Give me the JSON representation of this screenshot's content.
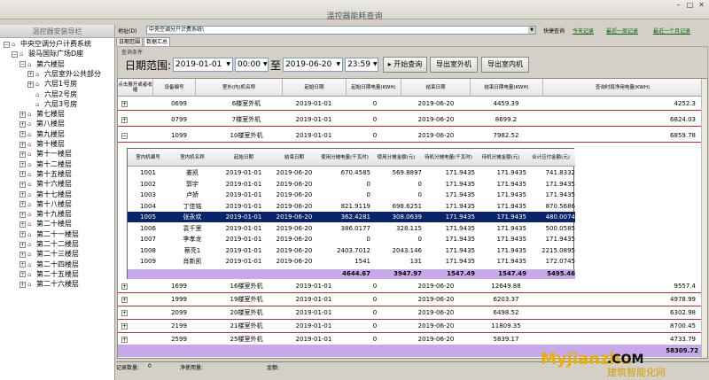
{
  "window": {
    "title": "温控器能耗查询"
  },
  "sidebar": {
    "header": "温控器安装导栏",
    "nodes": [
      {
        "label": "中央空调分户计费系统",
        "level": 0,
        "toggle": "⊟"
      },
      {
        "label": "骏马国际广场D座",
        "level": 1,
        "toggle": "⊟"
      },
      {
        "label": "第六楼层",
        "level": 2,
        "toggle": "⊟"
      },
      {
        "label": "六层室外公共部分",
        "level": 3,
        "toggle": "⊞"
      },
      {
        "label": "六层1号房",
        "level": 3,
        "toggle": "⊞"
      },
      {
        "label": "六层2号房",
        "level": 3,
        "toggle": ""
      },
      {
        "label": "六层3号房",
        "level": 3,
        "toggle": ""
      },
      {
        "label": "第七楼层",
        "level": 2,
        "toggle": "⊞"
      },
      {
        "label": "第八楼层",
        "level": 2,
        "toggle": "⊞"
      },
      {
        "label": "第九楼层",
        "level": 2,
        "toggle": "⊞"
      },
      {
        "label": "第十楼层",
        "level": 2,
        "toggle": "⊞"
      },
      {
        "label": "第十一楼层",
        "level": 2,
        "toggle": "⊞"
      },
      {
        "label": "第十二楼层",
        "level": 2,
        "toggle": "⊞"
      },
      {
        "label": "第十五楼层",
        "level": 2,
        "toggle": "⊞"
      },
      {
        "label": "第十六楼层",
        "level": 2,
        "toggle": "⊞"
      },
      {
        "label": "第十七楼层",
        "level": 2,
        "toggle": "⊞"
      },
      {
        "label": "第十八楼层",
        "level": 2,
        "toggle": "⊞"
      },
      {
        "label": "第十九楼层",
        "level": 2,
        "toggle": "⊞"
      },
      {
        "label": "第二十楼层",
        "level": 2,
        "toggle": "⊞"
      },
      {
        "label": "第二十一楼层",
        "level": 2,
        "toggle": "⊞"
      },
      {
        "label": "第二十二楼层",
        "level": 2,
        "toggle": "⊞"
      },
      {
        "label": "第二十三楼层",
        "level": 2,
        "toggle": "⊞"
      },
      {
        "label": "第二十四楼层",
        "level": 2,
        "toggle": "⊞"
      },
      {
        "label": "第二十五楼层",
        "level": 2,
        "toggle": "⊞"
      },
      {
        "label": "第二十六楼层",
        "level": 2,
        "toggle": "⊞"
      }
    ]
  },
  "topbar": {
    "path_label": "地址(D)",
    "path_value": "中央空调分户计费系统\\",
    "quick_label": "快捷查询",
    "links": [
      "今天记录",
      "最近一周记录",
      "最近一个月记录"
    ]
  },
  "tabs": [
    "日期范围",
    "数据汇总"
  ],
  "condition": {
    "title": "查询条件",
    "date_label": "日期范围:",
    "start_date": "2019-01-01",
    "start_time": "00:00",
    "to": "至",
    "end_date": "2019-06-20",
    "end_time": "23:59",
    "query_btn": "开始查询",
    "export_out_btn": "导出室外机",
    "export_in_btn": "导出室内机"
  },
  "grid": {
    "headers": [
      "点击展开或者收缩",
      "设备编号",
      "室外(内)机名称",
      "起始日期",
      "起始日期电量(KWH)",
      "结束日期",
      "结束日期电量(KWH)",
      "查询时段净用电量(KWH)"
    ],
    "rows_top": [
      {
        "id": "0699",
        "name": "6楼室外机",
        "start": "2019-01-01",
        "se": "0",
        "end": "2019-06-20",
        "ee": "4459.39",
        "net": "4252.3"
      },
      {
        "id": "0799",
        "name": "7楼室外机",
        "start": "2019-01-01",
        "se": "0",
        "end": "2019-06-20",
        "ee": "8699.2",
        "net": "6824.03"
      },
      {
        "id": "1099",
        "name": "10楼室外机",
        "start": "2019-01-01",
        "se": "0",
        "end": "2019-06-20",
        "ee": "7982.52",
        "net": "6859.78"
      }
    ],
    "rows_bottom": [
      {
        "id": "1699",
        "name": "16楼室外机",
        "start": "2019-01-01",
        "se": "0",
        "end": "2019-06-20",
        "ee": "12649.88",
        "net": "9557.4"
      },
      {
        "id": "1999",
        "name": "19楼室外机",
        "start": "2019-01-01",
        "se": "0",
        "end": "2019-06-20",
        "ee": "6203.37",
        "net": "4978.99"
      },
      {
        "id": "2099",
        "name": "20楼室外机",
        "start": "2019-01-01",
        "se": "0",
        "end": "2019-06-20",
        "ee": "6498.52",
        "net": "6302.98"
      },
      {
        "id": "2199",
        "name": "21楼室外机",
        "start": "2019-01-01",
        "se": "0",
        "end": "2019-06-20",
        "ee": "11809.35",
        "net": "8700.45"
      },
      {
        "id": "2599",
        "name": "25楼室外机",
        "start": "2019-01-01",
        "se": "0",
        "end": "2019-06-20",
        "ee": "5839.17",
        "net": "4733.79"
      }
    ],
    "grand_total": "58309.72"
  },
  "sub": {
    "headers": [
      "室内机编号",
      "室内机名称",
      "起始日期",
      "结束日期",
      "使用分摊电量(千瓦时)",
      "使用分摊金额(元)",
      "待机分摊电量(千瓦时)",
      "待机分摊金额(元)",
      "合计应付金额(元)"
    ],
    "rows": [
      [
        "1001",
        "姜凯",
        "2019-01-01",
        "2019-06-20",
        "670.4585",
        "569.8897",
        "171.9435",
        "171.9435",
        "741.8332"
      ],
      [
        "1002",
        "郭宇",
        "2019-01-01",
        "2019-06-20",
        "0",
        "0",
        "171.9435",
        "171.9435",
        "171.9435"
      ],
      [
        "1003",
        "卢娇",
        "2019-01-01",
        "2019-06-20",
        "0",
        "0",
        "171.9435",
        "171.9435",
        "171.9435"
      ],
      [
        "1004",
        "丁佳铭",
        "2019-01-01",
        "2019-06-20",
        "821.9119",
        "698.6251",
        "171.9435",
        "171.9435",
        "870.5686"
      ],
      [
        "1005",
        "张永欢",
        "2019-01-01",
        "2019-06-20",
        "362.4281",
        "308.0639",
        "171.9435",
        "171.9435",
        "480.0074"
      ],
      [
        "1006",
        "袁千里",
        "2019-01-01",
        "2019-06-20",
        "386.0177",
        "328.115",
        "171.9435",
        "171.9435",
        "500.0585"
      ],
      [
        "1007",
        "李孝龙",
        "2019-01-01",
        "2019-06-20",
        "0",
        "0",
        "171.9435",
        "171.9435",
        "171.9435"
      ],
      [
        "1008",
        "蔡亮1",
        "2019-01-01",
        "2019-06-20",
        "2403.7012",
        "2043.146",
        "171.9435",
        "171.9435",
        "2215.0895"
      ],
      [
        "1009",
        "肖新凯",
        "2019-01-01",
        "2019-06-20",
        "1541",
        "131",
        "171.9435",
        "171.9435",
        "172.0745"
      ]
    ],
    "selected": 4,
    "totals": [
      "4644.67",
      "3947.97",
      "1547.49",
      "1547.49",
      "5495.46"
    ]
  },
  "status": {
    "records_label": "记录数量:",
    "records": "0",
    "net_label": "净使用量:",
    "net": "",
    "amount_label": "金额:"
  },
  "watermark": {
    "a": "My",
    "b": "jianzhu",
    "c": ".COM",
    "d": "建筑智能化网"
  }
}
